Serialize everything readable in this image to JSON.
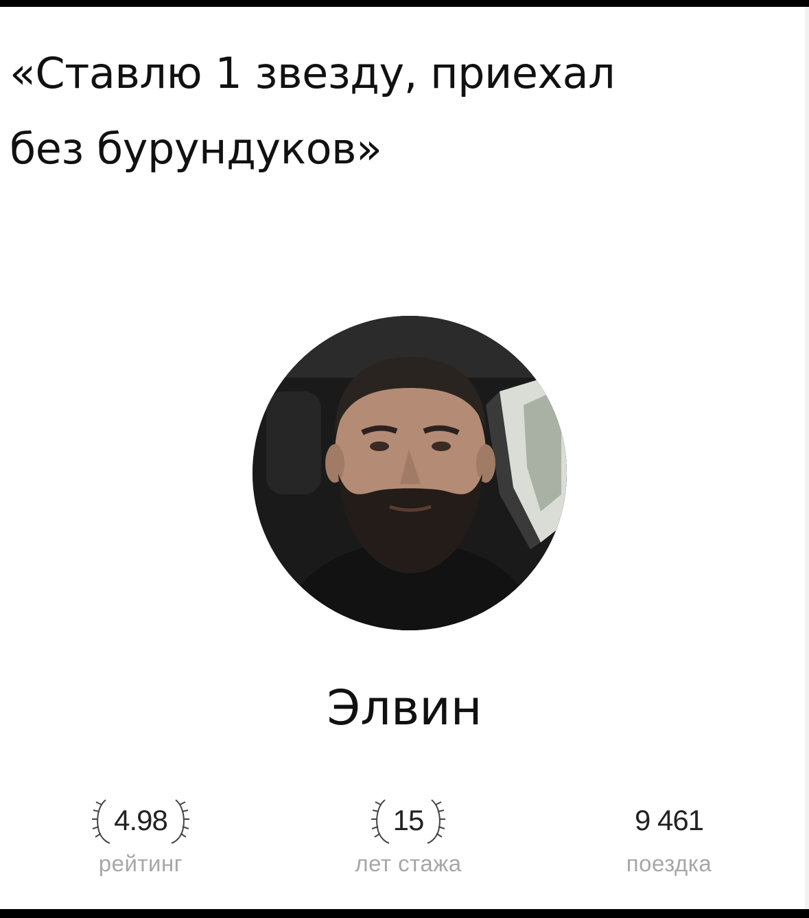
{
  "caption": {
    "line1": "«Ставлю 1 звезду, приехал",
    "line2": "без бурундуков»"
  },
  "driver": {
    "name": "Элвин"
  },
  "stats": [
    {
      "value": "4.98",
      "label": "рейтинг",
      "laurels": true
    },
    {
      "value": "15",
      "label": "лет стажа",
      "laurels": true
    },
    {
      "value": "9 461",
      "label": "поездка",
      "laurels": false
    }
  ],
  "colors": {
    "background": "#ffffff",
    "frame": "#000000",
    "text": "#111111",
    "label": "#a7a7a7"
  }
}
